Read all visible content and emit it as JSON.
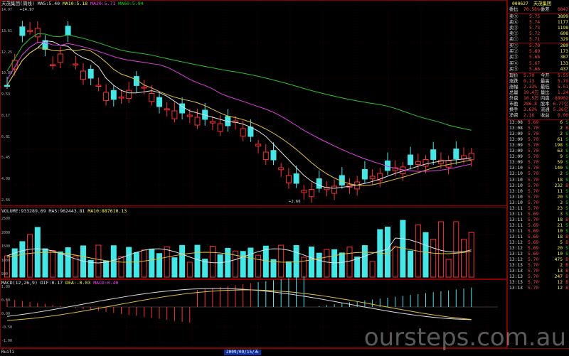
{
  "main_header": {
    "title": "天茂集团(周线)",
    "ma5": "MA5:5.40",
    "ma10": "MA10:5.18",
    "ma20": "MA20:5.71",
    "ma60": "MA60:5.94"
  },
  "volume_header": {
    "label": "VOLUME:933289.69",
    "ma5": "MA5:962443.81",
    "ma10": "MA10:887610.13"
  },
  "macd_header": {
    "label": "MACD(12,26,9)",
    "dif": "DIF:0.17",
    "dea": "DEA:-0.03",
    "macd": "MACD:0.40"
  },
  "annotations": {
    "high": "14.97",
    "low": "2.66"
  },
  "date_label": "2009/09/15/五",
  "bottom_left": "Ruili",
  "watermark": "oursteps.com.au",
  "colors": {
    "up": "#ff3030",
    "down": "#40e8e8",
    "ma5": "#e0e0e0",
    "ma10": "#e0c040",
    "ma20": "#e040e0",
    "ma60": "#30c030",
    "grid": "#8a0000"
  },
  "left_axis_price": [
    "14.97",
    "13.61",
    "12.25",
    "10.89",
    "9.53",
    "8.17",
    "6.81",
    "5.45",
    "4.08",
    "2.66"
  ],
  "left_axis_vol": [
    "2500",
    "2000",
    "1500",
    "1000",
    "500"
  ],
  "left_axis_macd": [
    "1.00",
    "0.50",
    "0.00",
    "-0.50",
    "-1.00"
  ],
  "quote": {
    "code_line": {
      "code": "000627",
      "name": "天茂集团"
    },
    "ratio": {
      "l1": "委比",
      "v1": "70.58%",
      "l2": "委差",
      "v2": "6842"
    },
    "sells": [
      {
        "label": "卖⑤",
        "price": "5.75",
        "vol": "3899"
      },
      {
        "label": "卖④",
        "price": "5.74",
        "vol": "1177"
      },
      {
        "label": "卖③",
        "price": "5.73",
        "vol": "1198"
      },
      {
        "label": "卖②",
        "price": "5.72",
        "vol": "608"
      },
      {
        "label": "卖①",
        "price": "5.71",
        "vol": "329"
      }
    ],
    "buys": [
      {
        "label": "买①",
        "price": "5.70",
        "vol": "289"
      },
      {
        "label": "买②",
        "price": "5.69",
        "vol": "173"
      },
      {
        "label": "买③",
        "price": "5.68",
        "vol": "387"
      },
      {
        "label": "买④",
        "price": "5.67",
        "vol": "133"
      },
      {
        "label": "买⑤",
        "price": "5.66",
        "vol": "437"
      }
    ],
    "stats": [
      {
        "l1": "现价",
        "v1": "5.70",
        "l2": "今开",
        "v2": "5.55"
      },
      {
        "l1": "涨跌",
        "v1": "0.13",
        "l2": "最高",
        "v2": "5.79"
      },
      {
        "l1": "涨幅",
        "v1": "2.33%",
        "l2": "最低",
        "v2": "5.51"
      },
      {
        "l1": "总量",
        "v1": "19.4万",
        "l2": "量比",
        "v2": "1.24"
      },
      {
        "l1": "外盘",
        "v1": "10.5万",
        "l2": "内盘",
        "v2": "88902"
      },
      {
        "l1": "市盈",
        "v1": "286.8",
        "l2": "股本",
        "v2": "6.77亿"
      },
      {
        "l1": "换手",
        "v1": "3.62%",
        "l2": "流通",
        "v2": "5.36亿"
      },
      {
        "l1": "净资",
        "v1": "2.16",
        "l2": "收益",
        "v2": "0.00"
      }
    ],
    "ticks": [
      {
        "t": "13:08",
        "p": "5.69",
        "v": "6",
        "d": "S"
      },
      {
        "t": "13:08",
        "p": "5.70",
        "v": "2",
        "d": "B"
      },
      {
        "t": "13:09",
        "p": "5.70",
        "v": "2",
        "d": "S"
      },
      {
        "t": "13:09",
        "p": "5.70",
        "v": "61",
        "d": "S"
      },
      {
        "t": "13:09",
        "p": "5.70",
        "v": "198",
        "d": "S"
      },
      {
        "t": "13:09",
        "p": "5.70",
        "v": "63",
        "d": "S"
      },
      {
        "t": "13:09",
        "p": "5.70",
        "v": "9",
        "d": "S"
      },
      {
        "t": "13:09",
        "p": "5.70",
        "v": "59",
        "d": "S"
      },
      {
        "t": "13:10",
        "p": "5.70",
        "v": "140",
        "d": "S"
      },
      {
        "t": "13:10",
        "p": "5.70",
        "v": "2",
        "d": "S"
      },
      {
        "t": "13:10",
        "p": "5.70",
        "v": "18",
        "d": "S"
      },
      {
        "t": "13:10",
        "p": "5.70",
        "v": "232",
        "d": "B"
      },
      {
        "t": "13:10",
        "p": "5.70",
        "v": "11",
        "d": "S"
      },
      {
        "t": "13:10",
        "p": "5.70",
        "v": "20",
        "d": "S"
      },
      {
        "t": "13:10",
        "p": "5.70",
        "v": "3",
        "d": "S"
      },
      {
        "t": "13:11",
        "p": "5.70",
        "v": "23",
        "d": "S"
      },
      {
        "t": "13:11",
        "p": "5.69",
        "v": "3",
        "d": "S"
      },
      {
        "t": "13:11",
        "p": "5.70",
        "v": "18",
        "d": "B"
      },
      {
        "t": "13:11",
        "p": "5.69",
        "v": "21",
        "d": "S"
      },
      {
        "t": "13:11",
        "p": "5.69",
        "v": "10",
        "d": "S"
      },
      {
        "t": "13:11",
        "p": "5.69",
        "v": "18",
        "d": "B"
      },
      {
        "t": "13:12",
        "p": "5.69",
        "v": "5",
        "d": "B"
      },
      {
        "t": "13:12",
        "p": "5.69",
        "v": "20",
        "d": "S"
      },
      {
        "t": "13:12",
        "p": "5.69",
        "v": "10",
        "d": "S"
      },
      {
        "t": "13:12",
        "p": "5.70",
        "v": "475",
        "d": "B"
      },
      {
        "t": "13:13",
        "p": "5.70",
        "v": "2",
        "d": "B"
      },
      {
        "t": "13:13",
        "p": "5.70",
        "v": "13",
        "d": "B"
      },
      {
        "t": "13:13",
        "p": "5.70",
        "v": "247",
        "d": "B"
      },
      {
        "t": "13:13",
        "p": "5.70",
        "v": "12",
        "d": "B"
      },
      {
        "t": "13:13",
        "p": "5.70",
        "v": "12",
        "d": "B"
      }
    ]
  }
}
